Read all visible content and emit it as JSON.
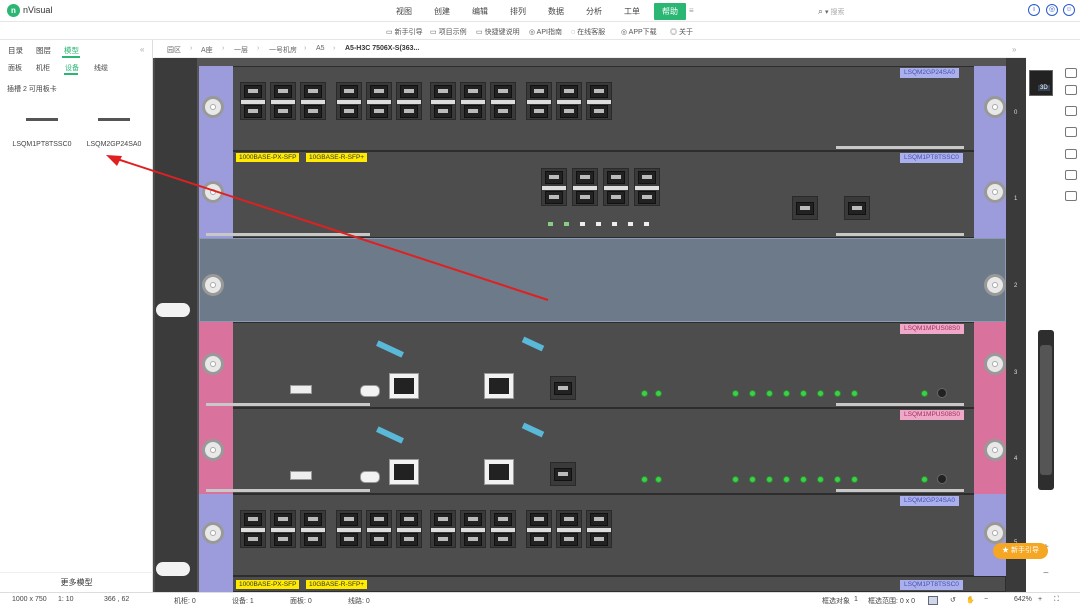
{
  "app": {
    "title": "nVisual",
    "logo_letter": "n"
  },
  "menu": {
    "items": [
      "视图",
      "创建",
      "编辑",
      "排列",
      "数据",
      "分析",
      "工单"
    ],
    "active": "帮助",
    "extra": "≡"
  },
  "search": {
    "placeholder": "搜索"
  },
  "helpbar": {
    "items": [
      "新手引导",
      "项目示例",
      "快捷键说明",
      "API指南",
      "在线客服",
      "APP下载",
      "关于"
    ]
  },
  "left_tabs": {
    "primary": [
      "目录",
      "图层",
      "模型"
    ],
    "primary_active": "模型",
    "secondary": [
      "面板",
      "机柜",
      "设备",
      "线缆"
    ],
    "secondary_active": "设备"
  },
  "slot_info": "插槽 2 可用板卡",
  "cards": [
    {
      "name": "LSQM1PT8TSSC0"
    },
    {
      "name": "LSQM2GP24SA0"
    }
  ],
  "more_models": "更多模型",
  "breadcrumb": [
    "园区",
    "A座",
    "一层",
    "一号机房",
    "A5",
    "A5-H3C 7506X-S(363..."
  ],
  "chassis": {
    "slots": [
      {
        "num": "0",
        "label": "LSQM2GP24SA0"
      },
      {
        "num": "1",
        "label": "LSQM1PT8TSSC0"
      },
      {
        "num": "2",
        "label": ""
      },
      {
        "num": "3",
        "label": "LSQM1MPUS08S0"
      },
      {
        "num": "4",
        "label": "LSQM1MPUS08S0"
      },
      {
        "num": "5",
        "label": "LSQM2GP24SA0"
      },
      {
        "num": "",
        "label": "LSQM1PT8TSSC0"
      }
    ],
    "tags": [
      "1000BASE-PX-SFP",
      "10GBASE-R-SFP+"
    ]
  },
  "view3d": "3D",
  "guide_button": "新手引导",
  "statusbar": {
    "canvas_size": "1000 x 750",
    "scale": "1: 10",
    "coords": "366 , 62",
    "cabinets": "机柜: 0",
    "devices": "设备: 1",
    "panels": "面板: 0",
    "cables": "线路: 0",
    "selected_objects_label": "框选对象",
    "selected_objects_value": "1",
    "selected_range": "框选范围: 0 x 0",
    "zoom": "642%"
  }
}
